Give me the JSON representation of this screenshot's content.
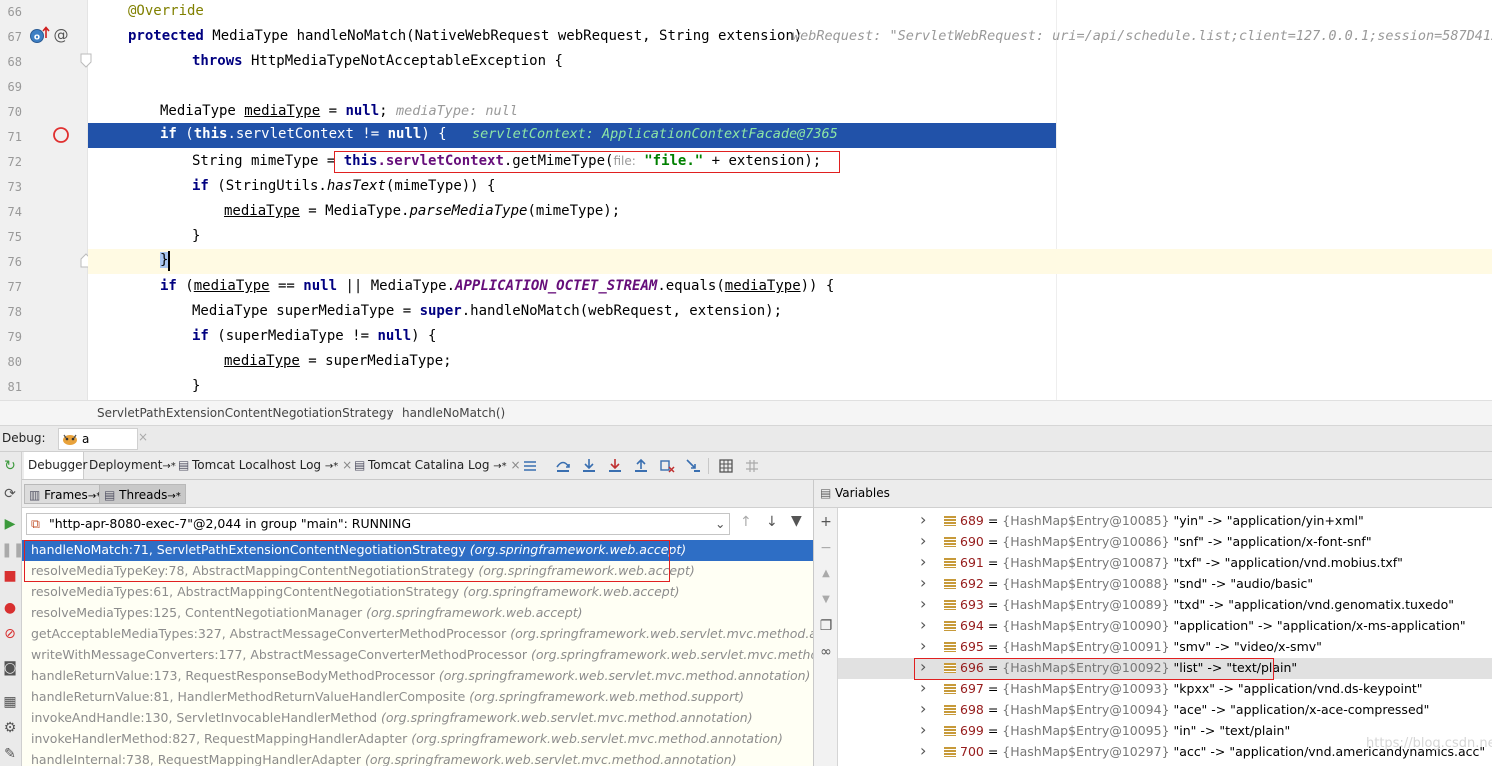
{
  "editor": {
    "line_numbers": [
      "66",
      "67",
      "68",
      "69",
      "70",
      "71",
      "72",
      "73",
      "74",
      "75",
      "76",
      "77",
      "78",
      "79",
      "80",
      "81"
    ],
    "lines": {
      "l66": {
        "annotation": "@Override"
      },
      "l67": {
        "kw": "protected",
        "sig": " MediaType handleNoMatch(NativeWebRequest webRequest, String extension)",
        "hint": "webRequest: \"ServletWebRequest: uri=/api/schedule.list;client=127.0.0.1;session=587D412("
      },
      "l68": {
        "kw": "throws",
        "rest": " HttpMediaTypeNotAcceptableException {"
      },
      "l70": {
        "type": "MediaType ",
        "var": "mediaType",
        "mid": " = ",
        "kw": "null",
        "end": ";",
        "hint": "mediaType: null"
      },
      "l71": {
        "kw1": "if",
        "p1": " (",
        "kw2": "this",
        "p2": ".servletContext != ",
        "kw3": "null",
        "p3": ") {",
        "hint": "servletContext: ApplicationContextFacade@7365"
      },
      "l72": {
        "pre": "String mimeType = ",
        "kw": "this",
        "fld": ".servletContext",
        "call": ".getMimeType(",
        "inlay": "file:",
        "str": " \"file.\"",
        "rest": " + extension);"
      },
      "l73": {
        "kw": "if",
        "p1": " (StringUtils.",
        "m": "hasText",
        "p2": "(mimeType)) {"
      },
      "l74": {
        "var": "mediaType",
        "p1": " = MediaType.",
        "m": "parseMediaType",
        "p2": "(mimeType);"
      },
      "l75": {
        "text": "}"
      },
      "l76": {
        "text": "}"
      },
      "l77": {
        "kw": "if",
        "p1": " (",
        "var": "mediaType",
        "p2": " == ",
        "kw2": "null",
        "p3": " || MediaType.",
        "cst": "APPLICATION_OCTET_STREAM",
        "p4": ".equals(",
        "var2": "mediaType",
        "p5": ")) {"
      },
      "l78": {
        "pre": "MediaType superMediaType = ",
        "kw": "super",
        "rest": ".handleNoMatch(webRequest, extension);"
      },
      "l79": {
        "kw": "if",
        "p1": " (superMediaType != ",
        "kw2": "null",
        "p2": ") {"
      },
      "l80": {
        "var": "mediaType",
        "rest": " = superMediaType;"
      },
      "l81": {
        "text": "}"
      }
    },
    "gutter_icons": [
      "override-icon",
      "at-icon",
      "breakpoint-icon"
    ]
  },
  "breadcrumb": {
    "class": "ServletPathExtensionContentNegotiationStrategy",
    "sep": "›",
    "method": "handleNoMatch()"
  },
  "debug": {
    "label": "Debug:",
    "session": "a",
    "tabs": [
      {
        "label": "Debugger"
      },
      {
        "label": "Deployment",
        "suffix": "→*"
      },
      {
        "label": "Tomcat Localhost Log",
        "suffix": "→*"
      },
      {
        "label": "Tomcat Catalina Log",
        "suffix": "→*"
      }
    ],
    "frames_tab": "Frames",
    "frames_suffix": "→*",
    "threads_tab": "Threads",
    "threads_suffix": "→*",
    "thread_select": "\"http-apr-8080-exec-7\"@2,044 in group \"main\": RUNNING",
    "frames": [
      {
        "method": "handleNoMatch:71, ServletPathExtensionContentNegotiationStrategy ",
        "pkg": "(org.springframework.web.accept)"
      },
      {
        "method": "resolveMediaTypeKey:78, AbstractMappingContentNegotiationStrategy ",
        "pkg": "(org.springframework.web.accept)"
      },
      {
        "method": "resolveMediaTypes:61, AbstractMappingContentNegotiationStrategy ",
        "pkg": "(org.springframework.web.accept)"
      },
      {
        "method": "resolveMediaTypes:125, ContentNegotiationManager ",
        "pkg": "(org.springframework.web.accept)"
      },
      {
        "method": "getAcceptableMediaTypes:327, AbstractMessageConverterMethodProcessor ",
        "pkg": "(org.springframework.web.servlet.mvc.method.annotatio"
      },
      {
        "method": "writeWithMessageConverters:177, AbstractMessageConverterMethodProcessor ",
        "pkg": "(org.springframework.web.servlet.mvc.method.annota"
      },
      {
        "method": "handleReturnValue:173, RequestResponseBodyMethodProcessor ",
        "pkg": "(org.springframework.web.servlet.mvc.method.annotation)"
      },
      {
        "method": "handleReturnValue:81, HandlerMethodReturnValueHandlerComposite ",
        "pkg": "(org.springframework.web.method.support)"
      },
      {
        "method": "invokeAndHandle:130, ServletInvocableHandlerMethod ",
        "pkg": "(org.springframework.web.servlet.mvc.method.annotation)"
      },
      {
        "method": "invokeHandlerMethod:827, RequestMappingHandlerAdapter ",
        "pkg": "(org.springframework.web.servlet.mvc.method.annotation)"
      },
      {
        "method": "handleInternal:738, RequestMappingHandlerAdapter ",
        "pkg": "(org.springframework.web.servlet.mvc.method.annotation)"
      }
    ],
    "variables_title": "Variables",
    "variables": [
      {
        "idx": "689",
        "cls": "{HashMap$Entry@10085}",
        "val": "\"yin\" -> \"application/yin+xml\""
      },
      {
        "idx": "690",
        "cls": "{HashMap$Entry@10086}",
        "val": "\"snf\" -> \"application/x-font-snf\""
      },
      {
        "idx": "691",
        "cls": "{HashMap$Entry@10087}",
        "val": "\"txf\" -> \"application/vnd.mobius.txf\""
      },
      {
        "idx": "692",
        "cls": "{HashMap$Entry@10088}",
        "val": "\"snd\" -> \"audio/basic\""
      },
      {
        "idx": "693",
        "cls": "{HashMap$Entry@10089}",
        "val": "\"txd\" -> \"application/vnd.genomatix.tuxedo\""
      },
      {
        "idx": "694",
        "cls": "{HashMap$Entry@10090}",
        "val": "\"application\" -> \"application/x-ms-application\""
      },
      {
        "idx": "695",
        "cls": "{HashMap$Entry@10091}",
        "val": "\"smv\" -> \"video/x-smv\""
      },
      {
        "idx": "696",
        "cls": "{HashMap$Entry@10092}",
        "val": "\"list\" -> \"text/plain\""
      },
      {
        "idx": "697",
        "cls": "{HashMap$Entry@10093}",
        "val": "\"kpxx\" -> \"application/vnd.ds-keypoint\""
      },
      {
        "idx": "698",
        "cls": "{HashMap$Entry@10094}",
        "val": "\"ace\" -> \"application/x-ace-compressed\""
      },
      {
        "idx": "699",
        "cls": "{HashMap$Entry@10095}",
        "val": "\"in\" -> \"text/plain\""
      },
      {
        "idx": "700",
        "cls": "{HashMap$Entry@10297}",
        "val": "\"acc\" -> \"application/vnd.americandynamics.acc\""
      }
    ],
    "watermark": "https://blog.csdn.net/qq_40039332",
    "eq": " = "
  },
  "colors": {
    "selection": "#2152a9",
    "frame_selected": "#2e6ec5",
    "highlight_box": "#e02020",
    "keyword": "#000080"
  }
}
